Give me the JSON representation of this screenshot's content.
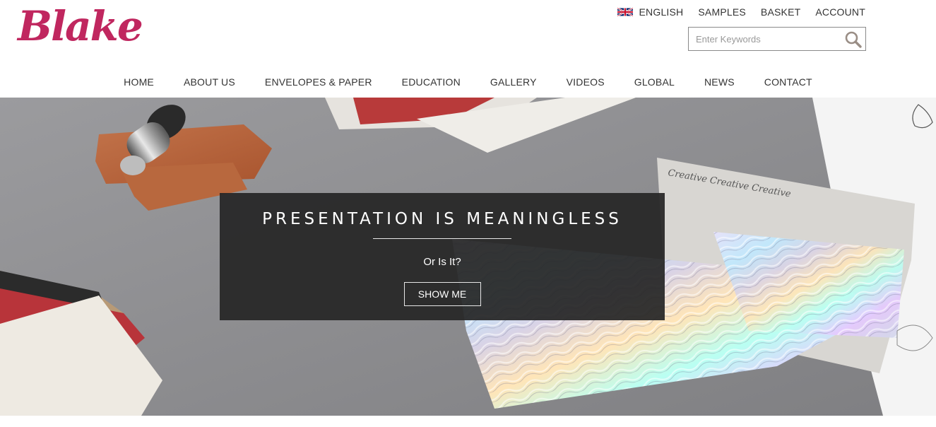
{
  "brand": {
    "logo_text": "Blake",
    "color": "#c0275f"
  },
  "top_links": {
    "language": "ENGLISH",
    "samples": "SAMPLES",
    "basket": "BASKET",
    "account": "ACCOUNT"
  },
  "search": {
    "placeholder": "Enter Keywords",
    "value": ""
  },
  "nav": {
    "items": [
      {
        "label": "HOME"
      },
      {
        "label": "ABOUT US"
      },
      {
        "label": "ENVELOPES & PAPER"
      },
      {
        "label": "EDUCATION"
      },
      {
        "label": "GALLERY"
      },
      {
        "label": "VIDEOS"
      },
      {
        "label": "GLOBAL"
      },
      {
        "label": "NEWS"
      },
      {
        "label": "CONTACT"
      }
    ]
  },
  "hero": {
    "title": "PRESENTATION IS MEANINGLESS",
    "subtitle": "Or Is It?",
    "button_label": "SHOW ME",
    "envelope_script": "Creative Creative Creative"
  },
  "icons": {
    "flag": "uk-flag-icon",
    "search": "search-icon"
  }
}
